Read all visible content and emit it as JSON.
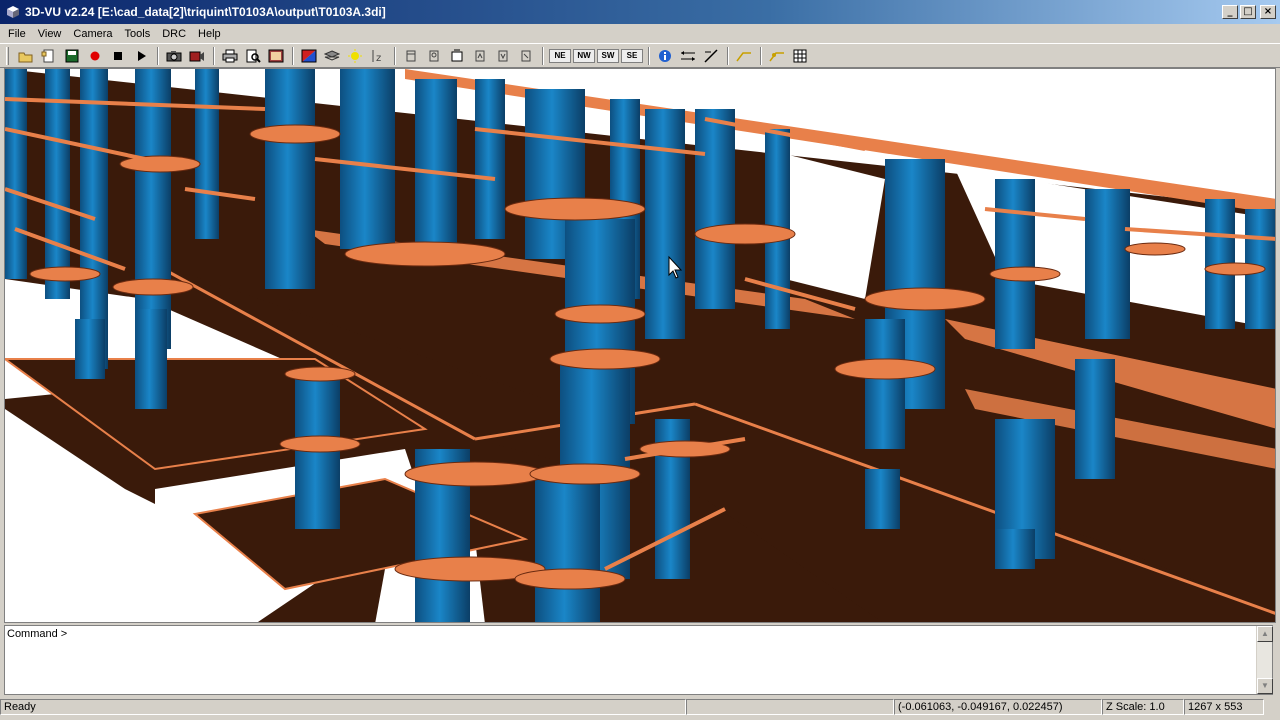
{
  "window": {
    "title": "3D-VU v2.24 [E:\\cad_data[2]\\triquint\\T0103A\\output\\T0103A.3di]",
    "icon": "app-cube-icon"
  },
  "menu": [
    "File",
    "View",
    "Camera",
    "Tools",
    "DRC",
    "Help"
  ],
  "toolbar": {
    "view_labels": [
      "NE",
      "NW",
      "SW",
      "SE"
    ],
    "icons": [
      "open-icon",
      "new-icon",
      "save-icon",
      "record-icon",
      "stop-icon",
      "play-icon",
      "camera-icon",
      "video-icon",
      "print-icon",
      "print-preview-icon",
      "export-icon",
      "color-icon",
      "layers-icon",
      "light-icon",
      "z-axis-icon",
      "view-front-icon",
      "view-back-icon",
      "view-top-icon",
      "view-left-icon",
      "view-right-icon",
      "view-iso-icon",
      "info-icon",
      "measure-icon",
      "probe-icon",
      "net-icon",
      "highlight-icon",
      "grid-icon"
    ]
  },
  "command": {
    "prompt": "Command >"
  },
  "status": {
    "state": "Ready",
    "coords": "(-0.061063, -0.049167, 0.022457)",
    "zscale": "Z Scale: 1.0",
    "size": "1267 x 553"
  },
  "colors": {
    "title_start": "#0a246a",
    "pillar": "#1a78b8",
    "pad": "#e8804a",
    "plate": "#3a1a0a"
  }
}
